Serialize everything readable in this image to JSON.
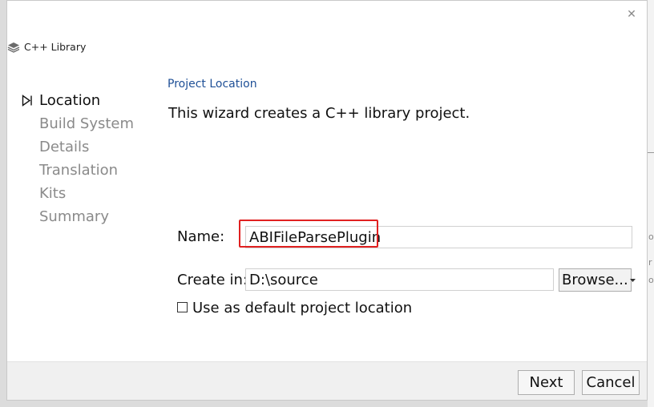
{
  "window": {
    "title": "C++ Library",
    "close_glyph": "✕"
  },
  "steps": [
    {
      "label": "Location",
      "state": "current"
    },
    {
      "label": "Build System",
      "state": "pending"
    },
    {
      "label": "Details",
      "state": "pending"
    },
    {
      "label": "Translation",
      "state": "pending"
    },
    {
      "label": "Kits",
      "state": "pending"
    },
    {
      "label": "Summary",
      "state": "pending"
    }
  ],
  "page": {
    "section_title": "Project Location",
    "description": "This wizard creates a C++ library project."
  },
  "form": {
    "name_label": "Name:",
    "name_value": "ABIFileParsePlugin",
    "create_in_label": "Create in:",
    "create_in_value": "D:\\source",
    "browse_label": "Browse...",
    "default_location_label": "Use as default project location",
    "default_location_checked": false
  },
  "footer": {
    "next_label": "Next",
    "cancel_label": "Cancel"
  },
  "background": {
    "partial_text": [
      "or",
      "r",
      "o"
    ]
  },
  "colors": {
    "section_title": "#1e4f96",
    "highlight": "#e02020",
    "pending_step": "#8a8a8a"
  },
  "icons": {
    "title": "layers-icon",
    "current_step": "play-outline-icon",
    "browse_dropdown": "chevron-down-icon",
    "close": "close-icon"
  }
}
